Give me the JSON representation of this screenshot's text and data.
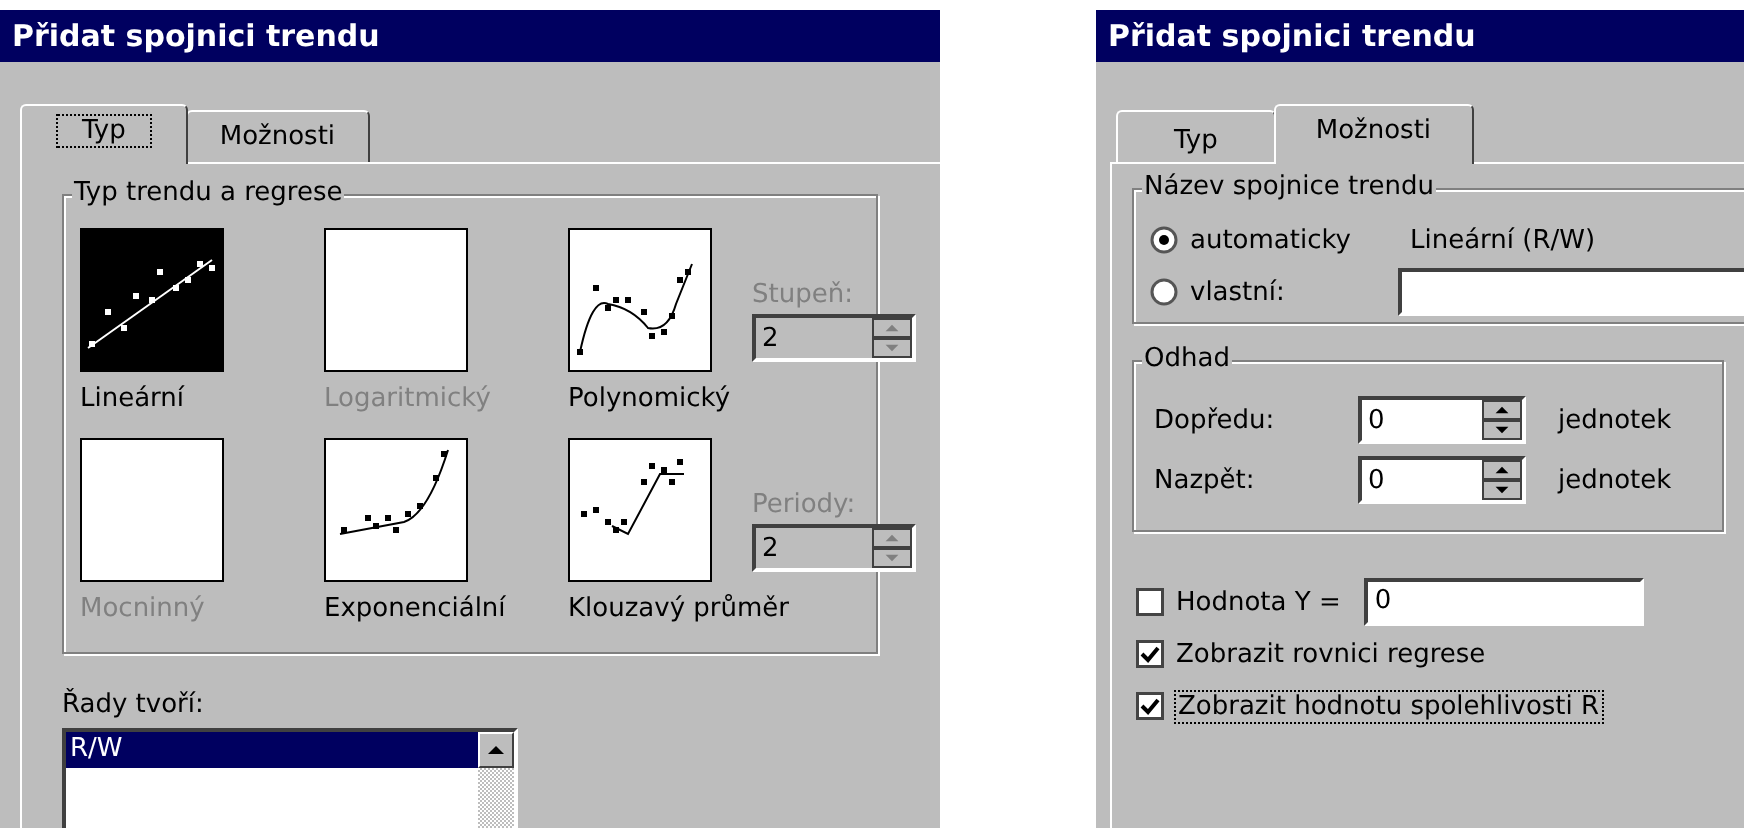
{
  "left_dialog": {
    "title": "Přidat spojnici trendu",
    "tabs": [
      {
        "label": "Typ",
        "selected": true
      },
      {
        "label": "Možnosti",
        "selected": false
      }
    ],
    "group_title": "Typ trendu a regrese",
    "trend_types": [
      {
        "kind": "linear",
        "label": "Lineární",
        "selected": true,
        "disabled": false
      },
      {
        "kind": "logarithmic",
        "label": "Logaritmický",
        "selected": false,
        "disabled": true
      },
      {
        "kind": "polynomial",
        "label": "Polynomický",
        "selected": false,
        "disabled": false
      },
      {
        "kind": "power",
        "label": "Mocninný",
        "selected": false,
        "disabled": true
      },
      {
        "kind": "exponential",
        "label": "Exponenciální",
        "selected": false,
        "disabled": false
      },
      {
        "kind": "moving_average",
        "label": "Klouzavý průměr",
        "selected": false,
        "disabled": false
      }
    ],
    "spinners": [
      {
        "label": "Stupeň:",
        "value": "2",
        "disabled": true
      },
      {
        "label": "Periody:",
        "value": "2",
        "disabled": true
      }
    ],
    "series_label": "Řady tvoří:",
    "series": [
      {
        "label": "R/W",
        "selected": true
      }
    ]
  },
  "right_dialog": {
    "title": "Přidat spojnici trendu",
    "tabs": [
      {
        "label": "Typ",
        "selected": false
      },
      {
        "label": "Možnosti",
        "selected": true
      }
    ],
    "name_group": {
      "title": "Název spojnice trendu",
      "options": [
        {
          "label": "automaticky",
          "selected": true
        },
        {
          "label": "vlastní:",
          "selected": false
        }
      ],
      "auto_name": "Lineární (R/W)"
    },
    "forecast_group": {
      "title": "Odhad",
      "rows": [
        {
          "label": "Dopředu:",
          "value": "0",
          "unit": "jednotek"
        },
        {
          "label": "Nazpět:",
          "value": "0",
          "unit": "jednotek"
        }
      ]
    },
    "intercept": {
      "label": "Hodnota Y =",
      "checked": false,
      "value": "0"
    },
    "checks": [
      {
        "label": "Zobrazit rovnici regrese",
        "checked": true,
        "focused": false
      },
      {
        "label": "Zobrazit hodnotu spolehlivosti R",
        "checked": true,
        "focused": true
      }
    ]
  }
}
